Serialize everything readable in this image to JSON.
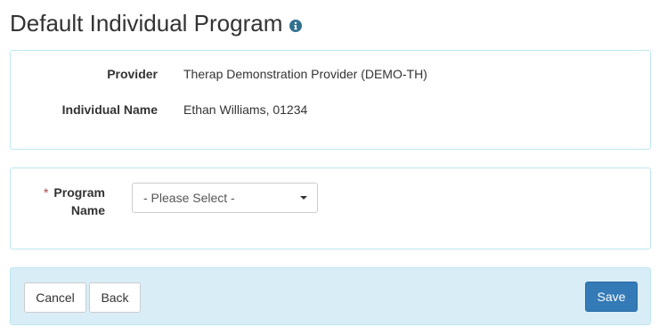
{
  "page": {
    "title": "Default Individual Program",
    "title_icon": "info-circle-icon"
  },
  "info": {
    "provider_label": "Provider",
    "provider_value": "Therap Demonstration Provider (DEMO-TH)",
    "individual_label": "Individual Name",
    "individual_value": "Ethan Williams, 01234"
  },
  "program": {
    "required_marker": "*",
    "label": "Program Name",
    "selected": "- Please Select -"
  },
  "footer": {
    "cancel_label": "Cancel",
    "back_label": "Back",
    "save_label": "Save"
  },
  "colors": {
    "panel_border": "#bce8f1",
    "footer_bg": "#d9edf7",
    "primary": "#337ab7",
    "required": "#a94442"
  }
}
